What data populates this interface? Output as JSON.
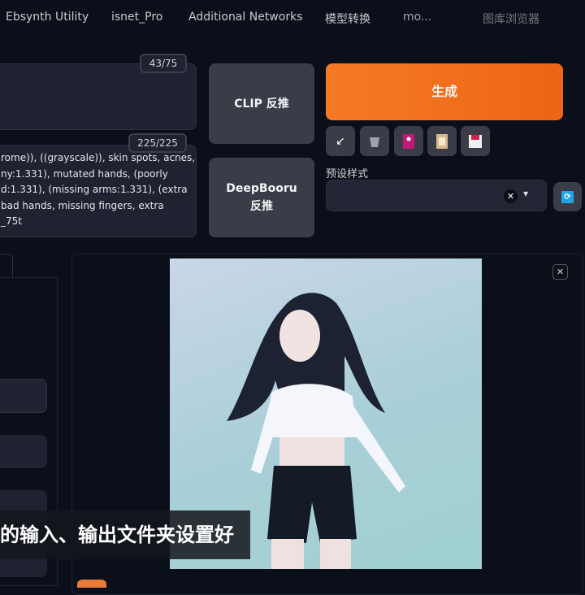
{
  "tabs": [
    "Ebsynth Utility",
    "isnet_Pro",
    "Additional Networks",
    "模型转换",
    "mo...",
    "图库浏览器"
  ],
  "prompt": {
    "counter": "43/75",
    "value": ""
  },
  "negative_prompt": {
    "counter": "225/225",
    "lines": [
      "rome)), ((grayscale)), skin spots, acnes,",
      "ny:1.331), mutated hands, (poorly",
      "d:1.331), (missing arms:1.331), (extra",
      "bad hands, missing fingers, extra",
      "_75t"
    ]
  },
  "buttons": {
    "clip": "CLIP 反推",
    "deepbooru": "DeepBooru 反推",
    "generate": "生成"
  },
  "tools": [
    "arrow-icon",
    "trash-icon",
    "image-icon",
    "clipboard-icon",
    "save-icon"
  ],
  "styles": {
    "label": "预设样式",
    "value": ""
  },
  "subtitle": "的输入、输出文件夹设置好",
  "colors": {
    "accent": "#f26b1d",
    "background": "#0b0f19",
    "refresh": "#1ea7e0"
  }
}
